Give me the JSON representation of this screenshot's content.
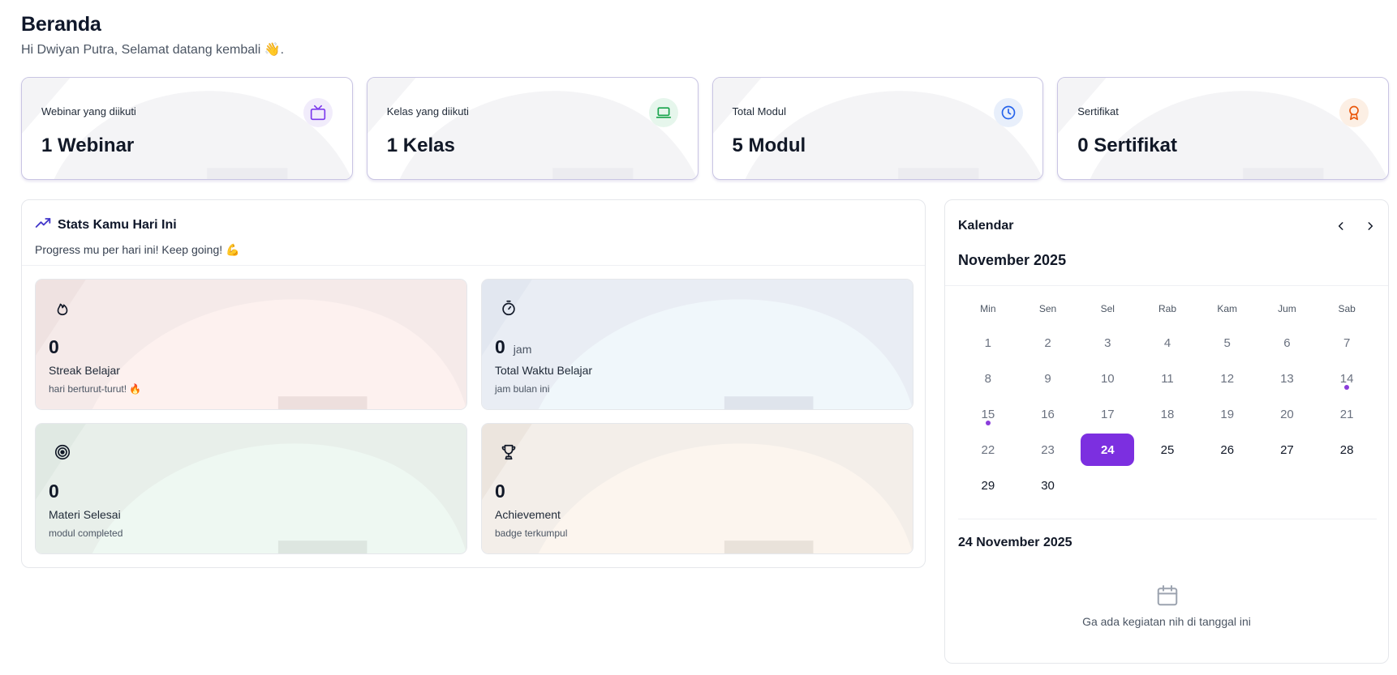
{
  "header": {
    "title": "Beranda",
    "subtitle": "Hi Dwiyan Putra, Selamat datang kembali 👋."
  },
  "summary_cards": [
    {
      "label": "Webinar yang diikuti",
      "value": "1 Webinar",
      "icon": "tv-icon",
      "color": "#7c3aed",
      "bg": "#f1ecfb"
    },
    {
      "label": "Kelas yang diikuti",
      "value": "1 Kelas",
      "icon": "laptop-icon",
      "color": "#16a34a",
      "bg": "#e6f6ec"
    },
    {
      "label": "Total Modul",
      "value": "5 Modul",
      "icon": "clock-icon",
      "color": "#2563eb",
      "bg": "#e8effb"
    },
    {
      "label": "Sertifikat",
      "value": "0 Sertifikat",
      "icon": "award-icon",
      "color": "#ea580c",
      "bg": "#fcefe4"
    }
  ],
  "stats": {
    "title": "Stats Kamu Hari Ini",
    "subtitle": "Progress mu per hari ini! Keep going! 💪",
    "tiles": [
      {
        "value": "0",
        "unit": "",
        "label": "Streak Belajar",
        "sub": "hari berturut-turut! 🔥",
        "icon": "flame-icon",
        "tint": "#fdeeee"
      },
      {
        "value": "0",
        "unit": "jam",
        "label": "Total Waktu Belajar",
        "sub": "jam bulan ini",
        "icon": "stopwatch-icon",
        "tint": "#e9f1f8"
      },
      {
        "value": "0",
        "unit": "",
        "label": "Materi Selesai",
        "sub": "modul completed",
        "icon": "target-icon",
        "tint": "#e8f3ee"
      },
      {
        "value": "0",
        "unit": "",
        "label": "Achievement",
        "sub": "badge terkumpul",
        "icon": "trophy-icon",
        "tint": "#f7efe7"
      }
    ]
  },
  "calendar": {
    "title": "Kalendar",
    "month": "November 2025",
    "weekdays": [
      "Min",
      "Sen",
      "Sel",
      "Rab",
      "Kam",
      "Jum",
      "Sab"
    ],
    "days": [
      "1",
      "2",
      "3",
      "4",
      "5",
      "6",
      "7",
      "8",
      "9",
      "10",
      "11",
      "12",
      "13",
      "14",
      "15",
      "16",
      "17",
      "18",
      "19",
      "20",
      "21",
      "22",
      "23",
      "24",
      "25",
      "26",
      "27",
      "28",
      "29",
      "30"
    ],
    "selected_day": "24",
    "event_days": [
      "14",
      "15"
    ],
    "selected_date_label": "24 November 2025",
    "empty_text": "Ga ada kegiatan nih di tanggal ini",
    "accent": "#7c2fe0"
  }
}
